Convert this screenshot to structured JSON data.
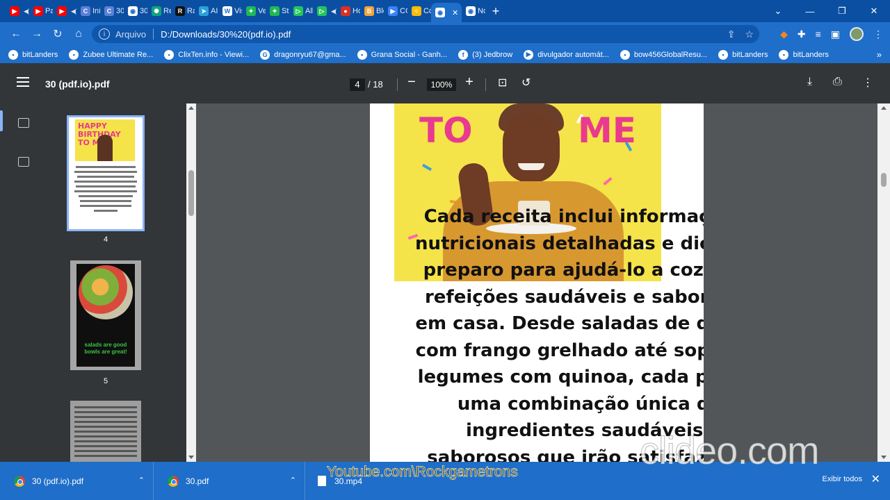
{
  "tabs": [
    {
      "title": "",
      "favicon": "youtube-icon",
      "color": "#ff0000",
      "extra": "speaker-icon"
    },
    {
      "title": "Pai",
      "favicon": "youtube-icon",
      "color": "#ff0000"
    },
    {
      "title": "",
      "favicon": "youtube-icon",
      "color": "#ff0000",
      "extra": "speaker-icon"
    },
    {
      "title": "Iní",
      "favicon": "clixten-icon",
      "color": "#5b7fd6"
    },
    {
      "title": "30",
      "favicon": "clixten-icon",
      "color": "#5b7fd6"
    },
    {
      "title": "30",
      "favicon": "globe-icon",
      "color": "#ffffff"
    },
    {
      "title": "Re",
      "favicon": "chatgpt-icon",
      "color": "#10a37f"
    },
    {
      "title": "Ra",
      "favicon": "r-icon",
      "color": "#111111"
    },
    {
      "title": "AI",
      "favicon": "telegram-icon",
      "color": "#2aa1da"
    },
    {
      "title": "Vis",
      "favicon": "wix-icon",
      "color": "#ffffff"
    },
    {
      "title": "Ve",
      "favicon": "green-icon",
      "color": "#1db954"
    },
    {
      "title": "Str",
      "favicon": "green-icon",
      "color": "#1db954"
    },
    {
      "title": "All",
      "favicon": "play-icon",
      "color": "#22c55e"
    },
    {
      "title": "",
      "favicon": "play-icon",
      "color": "#22c55e",
      "extra": "speaker-icon"
    },
    {
      "title": "Ho",
      "favicon": "drop-icon",
      "color": "#d93025"
    },
    {
      "title": "Blo",
      "favicon": "b-icon",
      "color": "#f4a43a"
    },
    {
      "title": "CC",
      "favicon": "play-triangle-icon",
      "color": "#3b82f6"
    },
    {
      "title": "Co",
      "favicon": "dots-icon",
      "color": "#fbbc05"
    },
    {
      "title": "",
      "favicon": "globe-icon",
      "color": "#ffffff",
      "active": true
    },
    {
      "title": "No",
      "favicon": "globe-icon",
      "color": "#ffffff"
    }
  ],
  "address": {
    "scheme": "Arquivo",
    "url": "D:/Downloads/30%20(pdf.io).pdf"
  },
  "bookmarks": [
    {
      "label": "bitLanders",
      "icon": "bitlanders-icon"
    },
    {
      "label": "Zubee Ultimate Re...",
      "icon": "zubee-icon"
    },
    {
      "label": "ClixTen.info - Viewi...",
      "icon": "clixten-icon"
    },
    {
      "label": "dragonryu67@gma...",
      "icon": "google-icon"
    },
    {
      "label": "Grana Social - Ganh...",
      "icon": "grana-icon"
    },
    {
      "label": "(3) Jedbrow",
      "icon": "facebook-icon"
    },
    {
      "label": "divulgador automát...",
      "icon": "youtube-icon"
    },
    {
      "label": "bow456GlobalResu...",
      "icon": "puzzle-icon"
    },
    {
      "label": "bitLanders",
      "icon": "image-icon"
    },
    {
      "label": "bitLanders",
      "icon": "bitlanders-icon"
    }
  ],
  "pdf": {
    "title": "30 (pdf.io).pdf",
    "page_current": "4",
    "page_total": "/ 18",
    "zoom": "100%"
  },
  "thumbnails": [
    {
      "label": "4",
      "heading": "HAPPY BIRTHDAY TO ME",
      "active": true
    },
    {
      "label": "5",
      "caption": "salads are good bowls are great!"
    },
    {
      "label": ""
    }
  ],
  "page_content": {
    "hero_words": [
      "TO",
      "ME"
    ],
    "lines": [
      "Cada receita inclui informaçõ",
      "nutricionais detalhadas e dica",
      "preparo para ajudá-lo a cozin",
      "refeições saudáveis e sabore",
      "em casa. Desde saladas de qu",
      "com frango grelhado até sopa",
      "legumes com quinoa, cada pr",
      "uma combinação única de",
      "ingredientes saudáveis e",
      "saborosos que irão satisfaze"
    ]
  },
  "downloads": [
    {
      "name": "30 (pdf.io).pdf",
      "icon": "chrome-icon"
    },
    {
      "name": "30.pdf",
      "icon": "chrome-icon"
    },
    {
      "name": "30.mp4",
      "icon": "file-icon"
    }
  ],
  "shelf": {
    "show_all": "Exibir todos"
  },
  "watermarks": {
    "clideo": "clideo.com",
    "youtube": "Youtube.com\\Rockgametrons"
  }
}
